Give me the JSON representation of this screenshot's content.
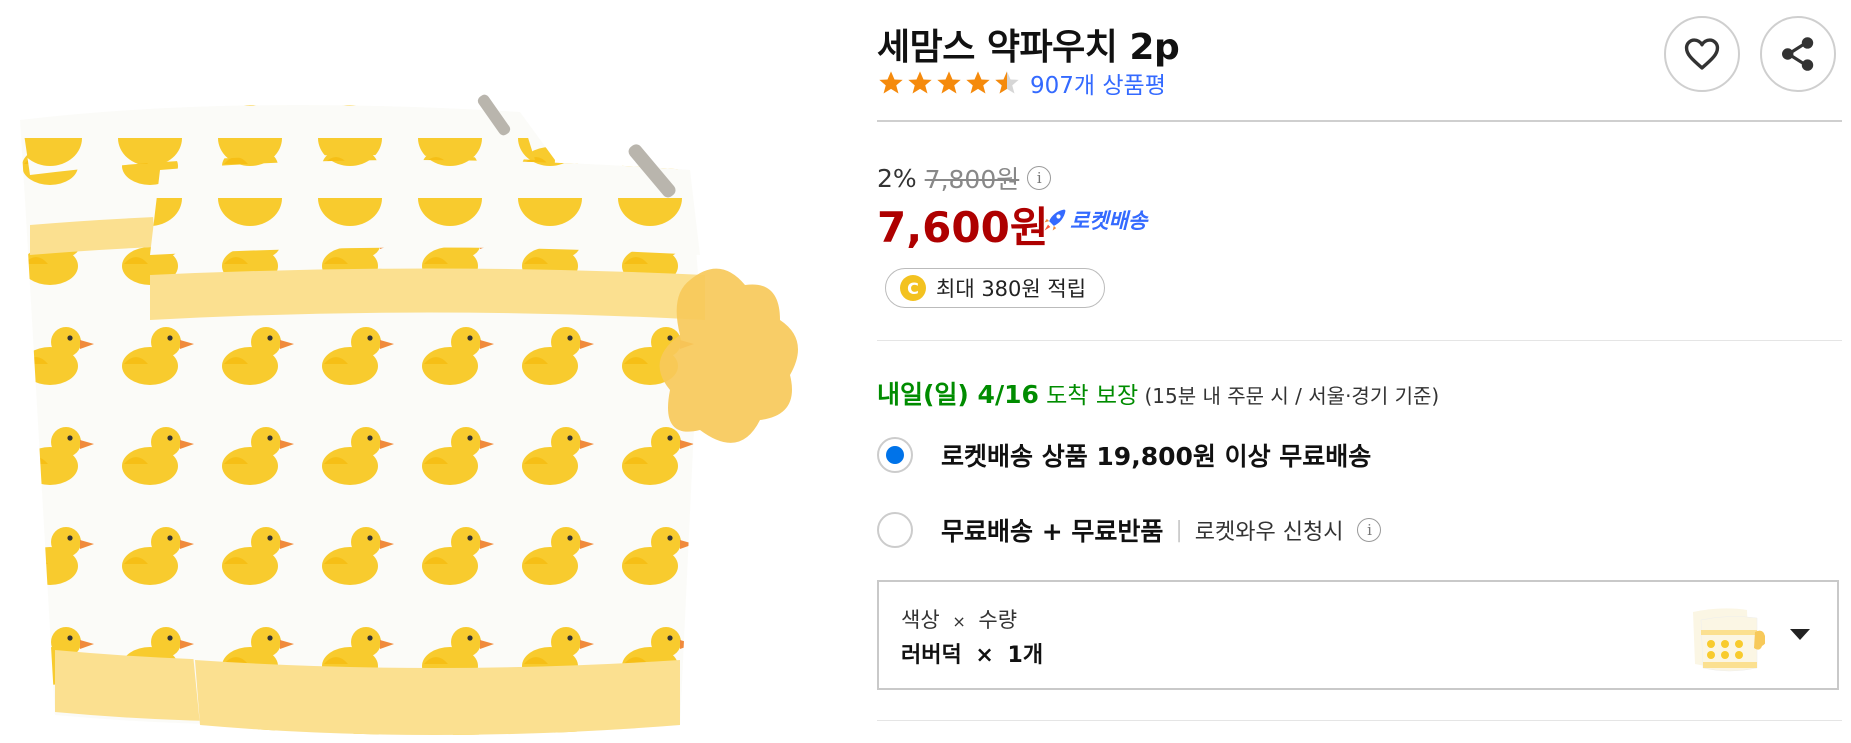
{
  "product": {
    "title": "세맘스 약파우치 2p",
    "review_count": "907개 상품평",
    "rating": 4.5
  },
  "actions": {
    "wishlist_icon": "heart-icon",
    "share_icon": "share-icon"
  },
  "pricing": {
    "discount_rate": "2%",
    "original_price": "7,800원",
    "info_glyph": "i",
    "sale_price": "7,600원",
    "rocket_label": "로켓배송",
    "reward_coin": "C",
    "reward_text": "최대 380원 적립"
  },
  "delivery": {
    "day": "내일(일) 4/16",
    "guarantee": " 도착 보장",
    "note": " (15분  내 주문 시 / 서울·경기 기준)"
  },
  "shipping_options": [
    {
      "label": "로켓배송 상품 19,800원 이상 무료배송",
      "selected": true
    },
    {
      "label": "무료배송 + 무료반품",
      "sub": "로켓와우 신청시",
      "selected": false
    }
  ],
  "option_selector": {
    "header_color": "색상",
    "header_times": "×",
    "header_qty": "수량",
    "value_color": "러버덕",
    "value_times": "×",
    "value_qty": "1개"
  },
  "colors": {
    "price_red": "#ae0000",
    "link_blue": "#346aff",
    "delivery_green": "#008c00",
    "radio_blue": "#0073e9",
    "star": "#f58a0c",
    "duck_yellow": "#f8cb2e",
    "pouch_trim": "#fbe090"
  }
}
